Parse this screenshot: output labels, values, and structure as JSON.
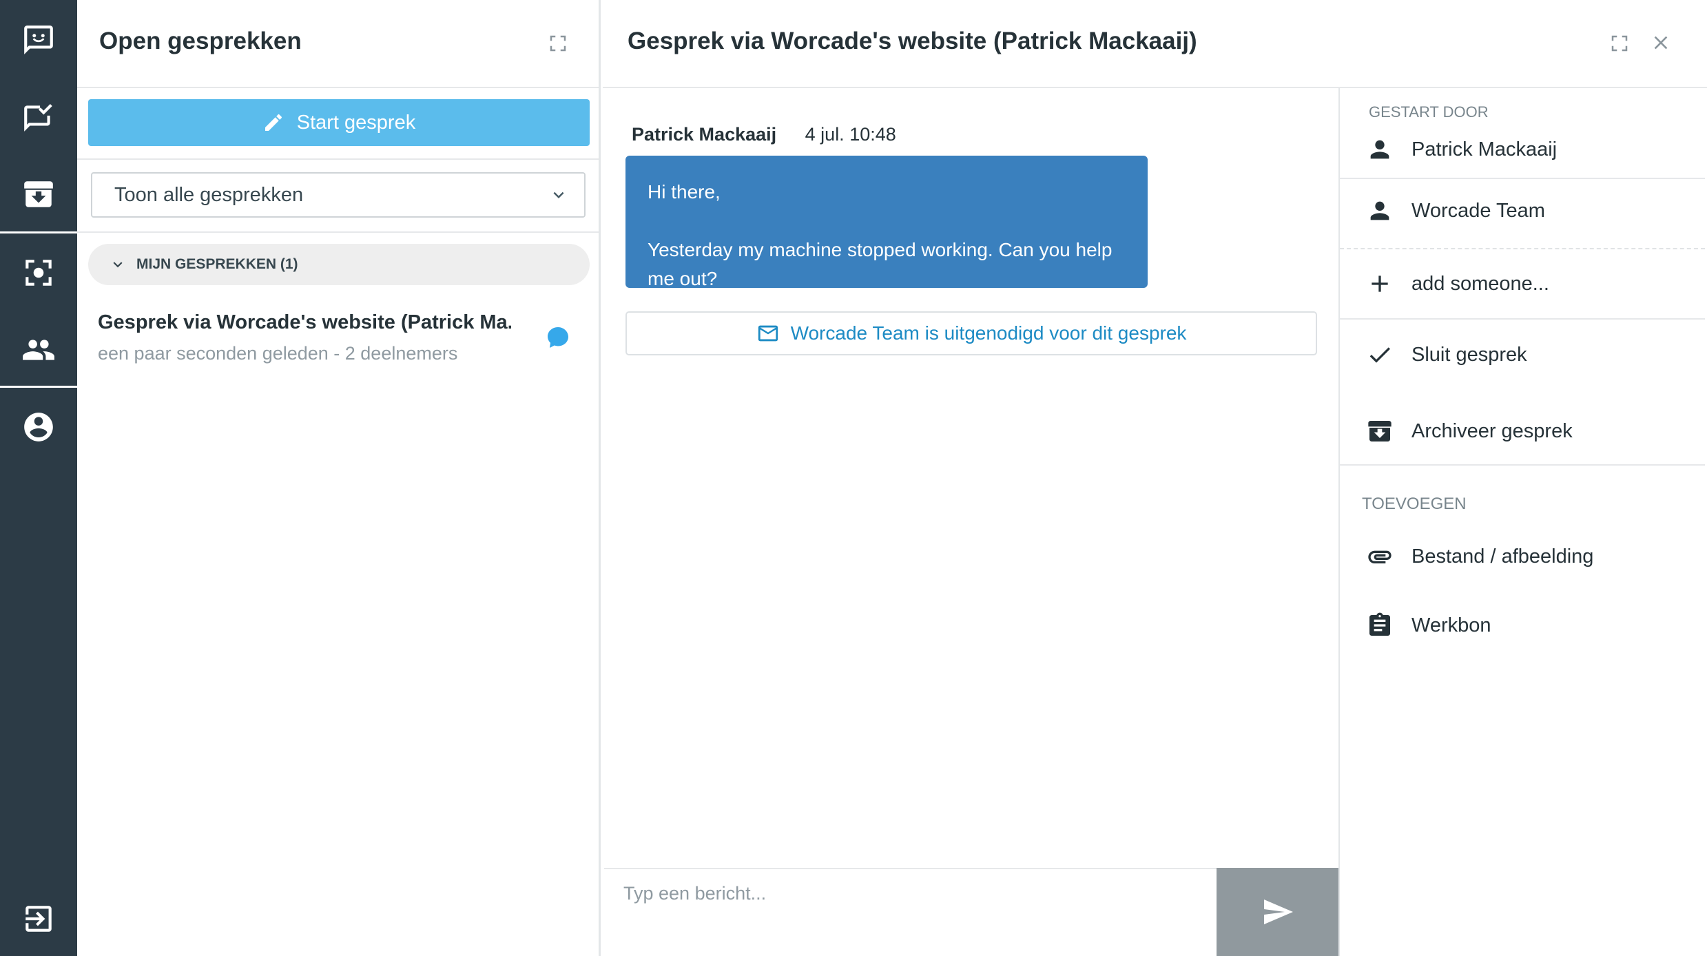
{
  "nav": {
    "items": [
      {
        "name": "conversations",
        "icon": "chat-icon"
      },
      {
        "name": "tasks",
        "icon": "chat-check-icon"
      },
      {
        "name": "archive",
        "icon": "archive-icon"
      },
      {
        "name": "scan",
        "icon": "scan-icon"
      },
      {
        "name": "contacts",
        "icon": "people-icon"
      },
      {
        "name": "account",
        "icon": "account-circle-icon"
      },
      {
        "name": "logout",
        "icon": "logout-icon"
      }
    ]
  },
  "list_panel": {
    "title": "Open gesprekken",
    "start_button": "Start gesprek",
    "filter": {
      "selected": "Toon alle gesprekken"
    },
    "group": {
      "label": "MIJN GESPREKKEN (1)"
    },
    "conversations": [
      {
        "title": "Gesprek via Worcade's website (Patrick Ma...",
        "subtitle": "een paar seconden geleden - 2 deelnemers"
      }
    ]
  },
  "chat": {
    "title": "Gesprek via Worcade's website (Patrick Mackaaij)",
    "message": {
      "author": "Patrick Mackaaij",
      "time": "4 jul. 10:48",
      "line1": "Hi there,",
      "line2": "Yesterday my machine stopped working. Can you help me out?"
    },
    "invite_notice": "Worcade Team is uitgenodigd voor dit gesprek",
    "composer_placeholder": "Typ een bericht..."
  },
  "details": {
    "started_by_label": "GESTART DOOR",
    "participants": [
      "Patrick Mackaaij",
      "Worcade Team"
    ],
    "add_someone": "add someone...",
    "close_conversation": "Sluit gesprek",
    "archive_conversation": "Archiveer gesprek",
    "add_label": "TOEVOEGEN",
    "attach_file": "Bestand / afbeelding",
    "work_order": "Werkbon"
  },
  "colors": {
    "rail": "#2c3b46",
    "primary_button": "#5bbcec",
    "message_bubble": "#3a80be",
    "link": "#1d8bc4",
    "send_button": "#90999e"
  }
}
